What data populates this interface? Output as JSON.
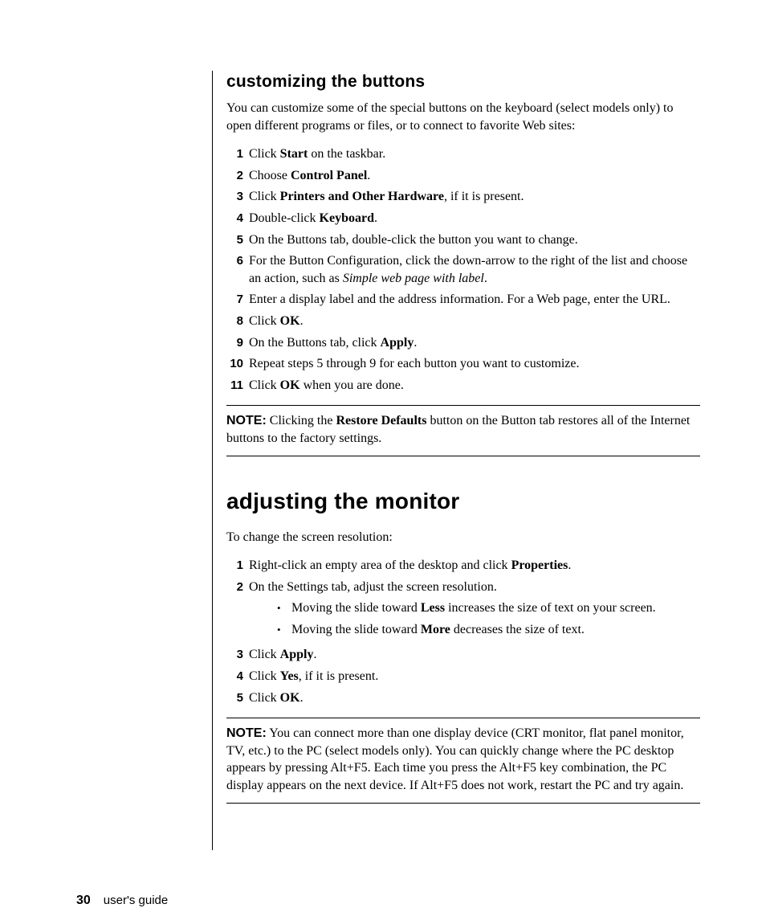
{
  "section1": {
    "heading": "customizing the buttons",
    "intro": "You can customize some of the special buttons on the keyboard (select models only) to open different programs or files, or to connect to favorite Web sites:",
    "steps": [
      {
        "pre": "Click ",
        "bold": "Start",
        "post": " on the taskbar."
      },
      {
        "pre": "Choose ",
        "bold": "Control Panel",
        "post": "."
      },
      {
        "pre": "Click ",
        "bold": "Printers and Other Hardware",
        "post": ", if it is present."
      },
      {
        "pre": "Double-click ",
        "bold": "Keyboard",
        "post": "."
      },
      {
        "pre": "On the Buttons tab, double-click the button you want to change.",
        "bold": "",
        "post": ""
      },
      {
        "pre": "For the Button Configuration, click the down-arrow to the right of the list and choose an action, such as ",
        "italic": "Simple web page with label",
        "post": "."
      },
      {
        "pre": "Enter a display label and the address information. For a Web page, enter the URL.",
        "bold": "",
        "post": ""
      },
      {
        "pre": "Click ",
        "bold": "OK",
        "post": "."
      },
      {
        "pre": "On the Buttons tab, click ",
        "bold": "Apply",
        "post": "."
      },
      {
        "pre": "Repeat steps 5 through 9 for each button you want to customize.",
        "bold": "",
        "post": ""
      },
      {
        "pre": "Click ",
        "bold": "OK",
        "post": " when you are done."
      }
    ],
    "note": {
      "label": "NOTE:",
      "pre": " Clicking the ",
      "bold": "Restore Defaults",
      "post": " button on the Button tab restores all of the Internet buttons to the factory settings."
    }
  },
  "section2": {
    "heading": "adjusting the monitor",
    "intro": "To change the screen resolution:",
    "steps": [
      {
        "pre": "Right-click an empty area of the desktop and click ",
        "bold": "Properties",
        "post": "."
      },
      {
        "pre": "On the Settings tab, adjust the screen resolution.",
        "bold": "",
        "post": "",
        "sub": [
          {
            "pre": "Moving the slide toward ",
            "bold": "Less",
            "post": " increases the size of text on your screen."
          },
          {
            "pre": "Moving the slide toward ",
            "bold": "More",
            "post": " decreases the size of text."
          }
        ]
      },
      {
        "pre": "Click ",
        "bold": "Apply",
        "post": "."
      },
      {
        "pre": "Click ",
        "bold": "Yes",
        "post": ", if it is present."
      },
      {
        "pre": "Click ",
        "bold": "OK",
        "post": "."
      }
    ],
    "note": {
      "label": "NOTE:",
      "text": " You can connect more than one display device (CRT monitor, flat panel monitor, TV, etc.) to the PC (select models only). You can quickly change where the PC desktop appears by pressing Alt+F5. Each time you press the Alt+F5 key combination, the PC display appears on the next device. If Alt+F5 does not work, restart the PC and try again."
    }
  },
  "footer": {
    "page": "30",
    "title": "user's guide"
  }
}
